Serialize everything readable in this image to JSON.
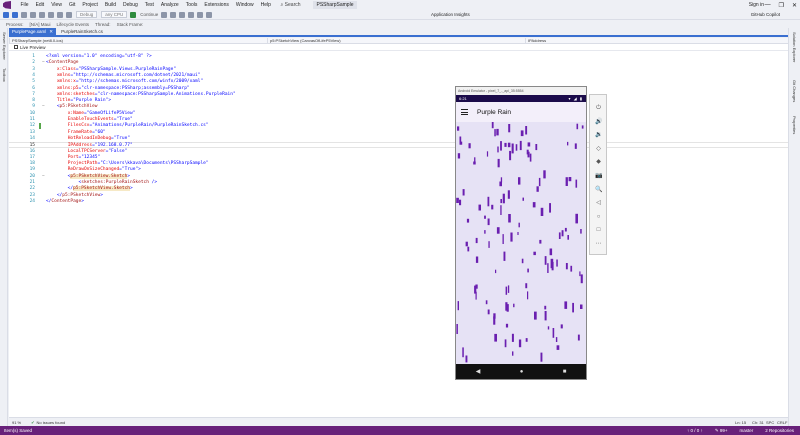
{
  "title_bar": {
    "menus": [
      "File",
      "Edit",
      "View",
      "Git",
      "Project",
      "Build",
      "Debug",
      "Test",
      "Analyze",
      "Tools",
      "Extensions",
      "Window",
      "Help"
    ],
    "search": "Search",
    "solution": "PSSharpSample",
    "sign_in": "Sign in",
    "controls": [
      "—",
      "❐",
      "✕"
    ]
  },
  "toolbar": {
    "config": "Debug",
    "platform": "any CPU",
    "continue": "Continue",
    "insights": "Application Insights",
    "copilot": "GitHub Copilot"
  },
  "process_bar": {
    "process_label": "Process:",
    "process_value": "[N/A] Maui",
    "lifecycle": "Lifecycle Events",
    "thread": "Thread:",
    "stack": "Stack Frame:"
  },
  "left_strip": [
    "Server Explorer",
    "Toolbox"
  ],
  "right_strip": [
    "Solution Explorer",
    "Git Changes",
    "Properties"
  ],
  "doc_tabs": [
    {
      "label": "PurplePage.xaml",
      "active": true
    },
    {
      "label": "PurpleRainSketch.cs",
      "active": false
    }
  ],
  "nav_bar": [
    "PSSharpSample (net8.0-ios)",
    "p5:PSketchView (CanvasOfLifeP5View)",
    "IPAddress"
  ],
  "live_preview": "Live Preview",
  "editor": {
    "current_line": 15,
    "lines": [
      {
        "n": 1,
        "tokens": [
          [
            "pun",
            "<?xml version=\"1.0\" encoding=\"utf-8\" ?>"
          ]
        ]
      },
      {
        "n": 2,
        "fold": "−",
        "tokens": [
          [
            "pun",
            "<"
          ],
          [
            "tag",
            "ContentPage"
          ]
        ]
      },
      {
        "n": 3,
        "tokens": [
          [
            "pun",
            "    "
          ],
          [
            "attr",
            "x:Class"
          ],
          [
            "pun",
            "=\""
          ],
          [
            "val",
            "PSSharpSample.Views.PurpleRainPage"
          ],
          [
            "pun",
            "\""
          ]
        ]
      },
      {
        "n": 4,
        "tokens": [
          [
            "pun",
            "    "
          ],
          [
            "attr",
            "xmlns"
          ],
          [
            "pun",
            "=\""
          ],
          [
            "val",
            "http://schemas.microsoft.com/dotnet/2021/maui"
          ],
          [
            "pun",
            "\""
          ]
        ]
      },
      {
        "n": 5,
        "tokens": [
          [
            "pun",
            "    "
          ],
          [
            "attr",
            "xmlns:x"
          ],
          [
            "pun",
            "=\""
          ],
          [
            "val",
            "http://schemas.microsoft.com/winfx/2009/xaml"
          ],
          [
            "pun",
            "\""
          ]
        ]
      },
      {
        "n": 6,
        "tokens": [
          [
            "pun",
            "    "
          ],
          [
            "attr",
            "xmlns:p5"
          ],
          [
            "pun",
            "=\""
          ],
          [
            "val",
            "clr-namespace:PSSharp;assembly=PSSharp"
          ],
          [
            "pun",
            "\""
          ]
        ]
      },
      {
        "n": 7,
        "tokens": [
          [
            "pun",
            "    "
          ],
          [
            "attr",
            "xmlns:sketches"
          ],
          [
            "pun",
            "=\""
          ],
          [
            "val",
            "clr-namespace:PSSharpSample.Animations.PurpleRain"
          ],
          [
            "pun",
            "\""
          ]
        ]
      },
      {
        "n": 8,
        "tokens": [
          [
            "pun",
            "    "
          ],
          [
            "attr",
            "Title"
          ],
          [
            "pun",
            "=\""
          ],
          [
            "val",
            "Purple Rain"
          ],
          [
            "pun",
            "\">"
          ]
        ]
      },
      {
        "n": 9,
        "fold": "−",
        "tokens": [
          [
            "pun",
            "    <"
          ],
          [
            "tag",
            "p5:PSketchView"
          ]
        ]
      },
      {
        "n": 10,
        "tokens": [
          [
            "pun",
            "        "
          ],
          [
            "attr",
            "x:Name"
          ],
          [
            "pun",
            "=\""
          ],
          [
            "val",
            "GameOfLifeP5View"
          ],
          [
            "pun",
            "\""
          ]
        ]
      },
      {
        "n": 11,
        "tokens": [
          [
            "pun",
            "        "
          ],
          [
            "attr",
            "EnableTouchEvents"
          ],
          [
            "pun",
            "=\""
          ],
          [
            "val",
            "True"
          ],
          [
            "pun",
            "\""
          ]
        ]
      },
      {
        "n": 12,
        "change": true,
        "tokens": [
          [
            "pun",
            "        "
          ],
          [
            "attr",
            "FilesCsv"
          ],
          [
            "pun",
            "=\""
          ],
          [
            "val",
            "Animations/PurpleRain/PurpleRainSketch.cs"
          ],
          [
            "pun",
            "\""
          ]
        ]
      },
      {
        "n": 13,
        "tokens": [
          [
            "pun",
            "        "
          ],
          [
            "attr",
            "FrameRate"
          ],
          [
            "pun",
            "=\""
          ],
          [
            "val",
            "60"
          ],
          [
            "pun",
            "\""
          ]
        ]
      },
      {
        "n": 14,
        "tokens": [
          [
            "pun",
            "        "
          ],
          [
            "attr",
            "HotReloadInDebug"
          ],
          [
            "pun",
            "=\""
          ],
          [
            "val",
            "True"
          ],
          [
            "pun",
            "\""
          ]
        ]
      },
      {
        "n": 15,
        "current": true,
        "tokens": [
          [
            "pun",
            "        "
          ],
          [
            "attr",
            "IPAddress"
          ],
          [
            "pun",
            "=\""
          ],
          [
            "val",
            "192.168.0.77"
          ],
          [
            "pun",
            "\""
          ]
        ]
      },
      {
        "n": 16,
        "tokens": [
          [
            "pun",
            "        "
          ],
          [
            "attr",
            "LocalTPCServer"
          ],
          [
            "pun",
            "=\""
          ],
          [
            "val",
            "False"
          ],
          [
            "pun",
            "\""
          ]
        ]
      },
      {
        "n": 17,
        "tokens": [
          [
            "pun",
            "        "
          ],
          [
            "attr",
            "Port"
          ],
          [
            "pun",
            "=\""
          ],
          [
            "val",
            "12345"
          ],
          [
            "pun",
            "\""
          ]
        ]
      },
      {
        "n": 18,
        "tokens": [
          [
            "pun",
            "        "
          ],
          [
            "attr",
            "ProjectPath"
          ],
          [
            "pun",
            "=\""
          ],
          [
            "val",
            "C:\\Users\\kkava\\Documents\\PSSharpSample"
          ],
          [
            "pun",
            "\""
          ]
        ]
      },
      {
        "n": 19,
        "tokens": [
          [
            "pun",
            "        "
          ],
          [
            "attr",
            "ReDrawOnSizeChanged"
          ],
          [
            "pun",
            "=\""
          ],
          [
            "val",
            "True"
          ],
          [
            "pun",
            "\">"
          ]
        ]
      },
      {
        "n": 20,
        "fold": "−",
        "tokens": [
          [
            "pun",
            "        <"
          ],
          [
            "tagHl",
            "p5:PSketchView.Sketch"
          ],
          [
            "pun",
            ">"
          ]
        ]
      },
      {
        "n": 21,
        "tokens": [
          [
            "pun",
            "            <"
          ],
          [
            "tag",
            "sketches:PurpleRainSketch"
          ],
          [
            "pun",
            " />"
          ]
        ]
      },
      {
        "n": 22,
        "tokens": [
          [
            "pun",
            "        </"
          ],
          [
            "tagHl",
            "p5:PSketchView.Sketch"
          ],
          [
            "pun",
            ">"
          ]
        ]
      },
      {
        "n": 23,
        "tokens": [
          [
            "pun",
            "    </"
          ],
          [
            "tag",
            "p5:PSketchView"
          ],
          [
            "pun",
            ">"
          ]
        ]
      },
      {
        "n": 24,
        "tokens": [
          [
            "pun",
            "</"
          ],
          [
            "tag",
            "ContentPage"
          ],
          [
            "pun",
            ">"
          ]
        ]
      }
    ]
  },
  "emulator": {
    "window_title": "Android Emulator - pixel_7_-_api_35:5554",
    "time": "6:21",
    "status_icons": "▾ ◢ ▮",
    "app_title": "Purple Rain",
    "nav_buttons": [
      "◀",
      "●",
      "■"
    ],
    "drop_color": "#6a1fb0",
    "background": "#e6e2f5"
  },
  "emulator_tools": [
    "⏻",
    "🔊",
    "🔉",
    "◇",
    "◆",
    "📷",
    "🔍",
    "◁",
    "○",
    "□",
    "⋯"
  ],
  "editor_status": {
    "zoom": "91 %",
    "issues": "No issues found",
    "position": "Ln: 15",
    "column": "Ch: 31",
    "spc": "SPC",
    "crlf": "CRLF"
  },
  "status_bar": {
    "left": "Item(s) Saved",
    "right": [
      "↑ 0 / 0 ↑",
      "✎ 99+",
      "master",
      "2 Repositories"
    ]
  }
}
